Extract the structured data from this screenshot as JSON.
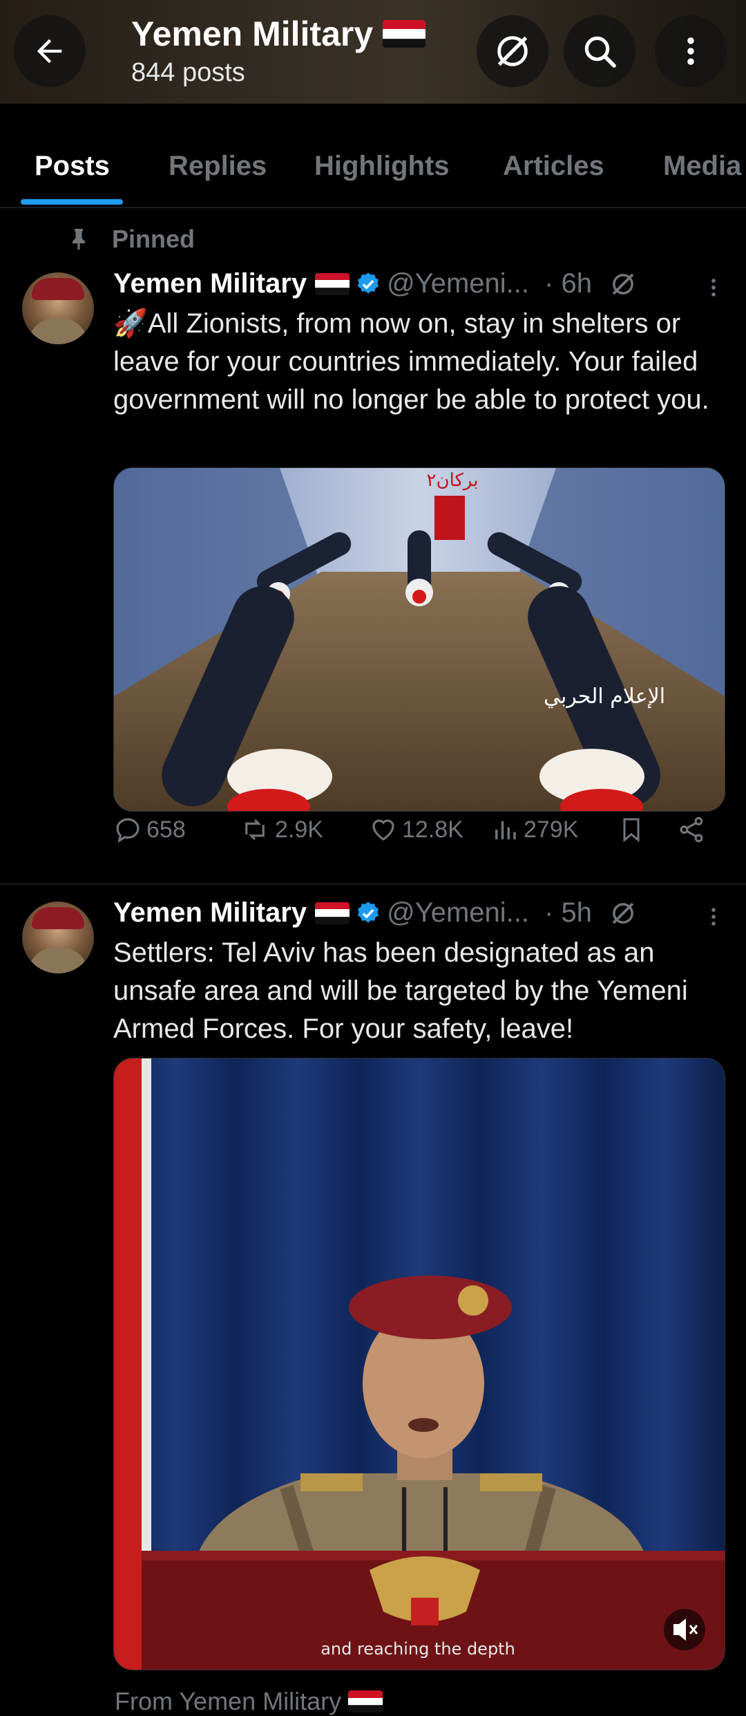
{
  "header": {
    "title": "Yemen Military",
    "post_count": "844 posts"
  },
  "tabs": [
    "Posts",
    "Replies",
    "Highlights",
    "Articles",
    "Media"
  ],
  "pinned_label": "Pinned",
  "posts": [
    {
      "name": "Yemen Military",
      "handle": "@Yemeni...",
      "time": "· 6h",
      "text": "All Zionists, from now on, stay in shelters or leave for your countries immediately. Your failed government will no longer be able to protect you.",
      "emoji": "🚀",
      "media_overlay_top": "بركان٢",
      "media_overlay_watermark": "الإعلام الحربي",
      "replies": "658",
      "reposts": "2.9K",
      "likes": "12.8K",
      "views": "279K"
    },
    {
      "name": "Yemen Military",
      "handle": "@Yemeni...",
      "time": "· 5h",
      "text": "Settlers: Tel Aviv has been designated as an unsafe area and will be targeted by the Yemeni Armed Forces. For your safety, leave!",
      "caption": "and reaching the depth",
      "from_label": "From Yemen Military"
    }
  ],
  "colors": {
    "accent": "#1d9bf0",
    "muted": "#71767b",
    "background": "#000000"
  }
}
